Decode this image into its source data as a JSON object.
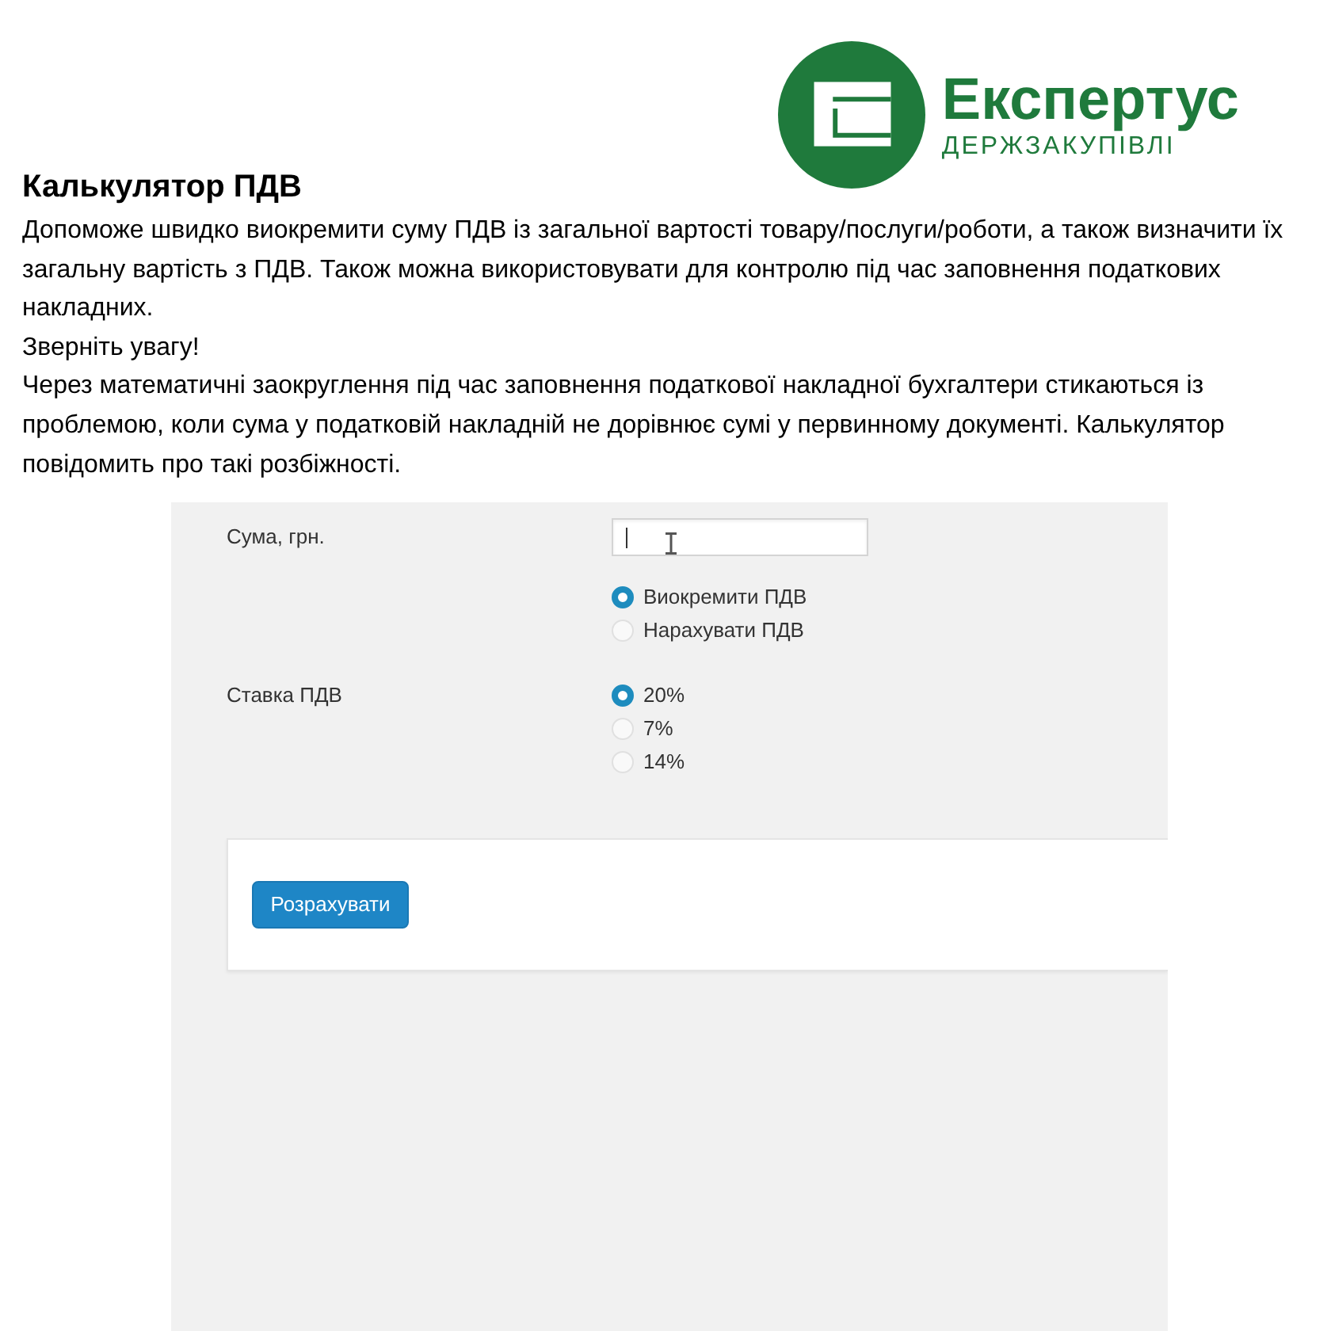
{
  "logo": {
    "name": "Експертус",
    "tagline": "ДЕРЖЗАКУПІВЛІ"
  },
  "title": "Калькулятор ПДВ",
  "paragraphs": [
    "Допоможе швидко виокремити суму ПДВ із загальної вартості товару/послуги/роботи, а також визначити їх загальну вартість з ПДВ. Також можна використовувати для контролю під час заповнення податкових накладних.",
    "Зверніть увагу!",
    "Через математичні заокруглення під час заповнення податкової накладної бухгалтери стикаються із проблемою, коли сума у податковій накладній не дорівнює сумі у первинному документі. Калькулятор повідомить про такі розбіжності."
  ],
  "calculator": {
    "amount": {
      "label": "Сума, грн.",
      "focused": true
    },
    "mode": [
      {
        "label": "Виокремити ПДВ",
        "selected": true
      },
      {
        "label": "Нарахувати ПДВ",
        "selected": false
      }
    ],
    "rate": {
      "label": "Ставка ПДВ",
      "options": [
        {
          "label": "20%",
          "selected": true
        },
        {
          "label": "7%",
          "selected": false
        },
        {
          "label": "14%",
          "selected": false
        }
      ]
    },
    "button": "Розрахувати"
  }
}
